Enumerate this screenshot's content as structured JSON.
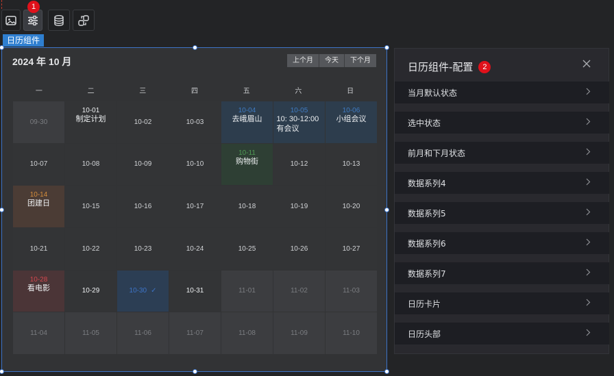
{
  "toolbar": {
    "buttons": [
      {
        "icon": "image-icon"
      },
      {
        "icon": "sliders-icon",
        "badge": "1"
      },
      {
        "icon": "database-icon"
      },
      {
        "icon": "link-icon"
      }
    ]
  },
  "component_tag": "日历组件",
  "calendar": {
    "title": "2024 年 10 月",
    "nav": {
      "prev": "上个月",
      "today": "今天",
      "next": "下个月"
    },
    "weekdays": [
      "一",
      "二",
      "三",
      "四",
      "五",
      "六",
      "日"
    ],
    "cells": [
      {
        "date": "09-30",
        "style": "other"
      },
      {
        "date": "10-01",
        "event": "制定计划",
        "style": "bright"
      },
      {
        "date": "10-02"
      },
      {
        "date": "10-03"
      },
      {
        "date": "10-04",
        "event": "去峨眉山",
        "style": "blue"
      },
      {
        "date": "10-05",
        "event": "10: 30-12:00 有会议",
        "style": "blue"
      },
      {
        "date": "10-06",
        "event": "小组会议",
        "style": "blue"
      },
      {
        "date": "10-07"
      },
      {
        "date": "10-08"
      },
      {
        "date": "10-09"
      },
      {
        "date": "10-10"
      },
      {
        "date": "10-11",
        "event": "购物街",
        "style": "green"
      },
      {
        "date": "10-12"
      },
      {
        "date": "10-13"
      },
      {
        "date": "10-14",
        "event": "团建日",
        "style": "orange"
      },
      {
        "date": "10-15"
      },
      {
        "date": "10-16"
      },
      {
        "date": "10-17"
      },
      {
        "date": "10-18"
      },
      {
        "date": "10-19"
      },
      {
        "date": "10-20"
      },
      {
        "date": "10-21"
      },
      {
        "date": "10-22"
      },
      {
        "date": "10-23"
      },
      {
        "date": "10-24"
      },
      {
        "date": "10-25"
      },
      {
        "date": "10-26"
      },
      {
        "date": "10-27"
      },
      {
        "date": "10-28",
        "event": "看电影",
        "style": "red"
      },
      {
        "date": "10-29",
        "style": "bright"
      },
      {
        "date": "10-30",
        "check": "✓",
        "style": "selected"
      },
      {
        "date": "10-31",
        "style": "bright"
      },
      {
        "date": "11-01",
        "style": "other"
      },
      {
        "date": "11-02",
        "style": "other"
      },
      {
        "date": "11-03",
        "style": "other"
      },
      {
        "date": "11-04",
        "style": "other"
      },
      {
        "date": "11-05",
        "style": "other"
      },
      {
        "date": "11-06",
        "style": "other"
      },
      {
        "date": "11-07",
        "style": "other"
      },
      {
        "date": "11-08",
        "style": "other"
      },
      {
        "date": "11-09",
        "style": "other"
      },
      {
        "date": "11-10",
        "style": "other"
      }
    ]
  },
  "panel": {
    "title": "日历组件-配置",
    "badge": "2",
    "items": [
      "当月默认状态",
      "选中状态",
      "前月和下月状态",
      "数据系列4",
      "数据系列5",
      "数据系列6",
      "数据系列7",
      "日历卡片",
      "日历头部"
    ]
  },
  "colors": {
    "accent": "#3d74c8",
    "badge": "#e0111b",
    "background": "#232426"
  }
}
